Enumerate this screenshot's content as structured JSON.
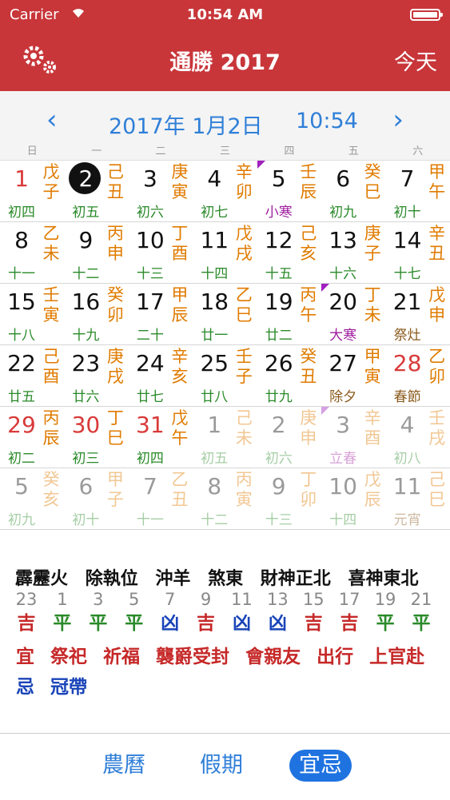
{
  "status": {
    "carrier": "Carrier",
    "time": "10:54 AM"
  },
  "nav": {
    "title": "通勝 2017",
    "today": "今天"
  },
  "subhead": {
    "date": "2017年 1月2日",
    "clock": "10:54",
    "prev": "‹",
    "next": "›"
  },
  "weekdays": [
    "日",
    "一",
    "二",
    "三",
    "四",
    "五",
    "六"
  ],
  "calendar": [
    [
      {
        "day": "1",
        "gz": "戊子",
        "lunar": "初四",
        "red": true
      },
      {
        "day": "2",
        "gz": "己丑",
        "lunar": "初五",
        "selected": true
      },
      {
        "day": "3",
        "gz": "庚寅",
        "lunar": "初六"
      },
      {
        "day": "4",
        "gz": "辛卯",
        "lunar": "初七"
      },
      {
        "day": "5",
        "gz": "壬辰",
        "lunar": "小寒",
        "term": true
      },
      {
        "day": "6",
        "gz": "癸巳",
        "lunar": "初九"
      },
      {
        "day": "7",
        "gz": "甲午",
        "lunar": "初十"
      }
    ],
    [
      {
        "day": "8",
        "gz": "乙未",
        "lunar": "十一"
      },
      {
        "day": "9",
        "gz": "丙申",
        "lunar": "十二"
      },
      {
        "day": "10",
        "gz": "丁酉",
        "lunar": "十三"
      },
      {
        "day": "11",
        "gz": "戊戌",
        "lunar": "十四"
      },
      {
        "day": "12",
        "gz": "己亥",
        "lunar": "十五"
      },
      {
        "day": "13",
        "gz": "庚子",
        "lunar": "十六"
      },
      {
        "day": "14",
        "gz": "辛丑",
        "lunar": "十七"
      }
    ],
    [
      {
        "day": "15",
        "gz": "壬寅",
        "lunar": "十八"
      },
      {
        "day": "16",
        "gz": "癸卯",
        "lunar": "十九"
      },
      {
        "day": "17",
        "gz": "甲辰",
        "lunar": "二十"
      },
      {
        "day": "18",
        "gz": "乙巳",
        "lunar": "廿一"
      },
      {
        "day": "19",
        "gz": "丙午",
        "lunar": "廿二"
      },
      {
        "day": "20",
        "gz": "丁未",
        "lunar": "大寒",
        "term": true
      },
      {
        "day": "21",
        "gz": "戊申",
        "lunar": "祭灶",
        "fest": true
      }
    ],
    [
      {
        "day": "22",
        "gz": "己酉",
        "lunar": "廿五"
      },
      {
        "day": "23",
        "gz": "庚戌",
        "lunar": "廿六"
      },
      {
        "day": "24",
        "gz": "辛亥",
        "lunar": "廿七"
      },
      {
        "day": "25",
        "gz": "壬子",
        "lunar": "廿八"
      },
      {
        "day": "26",
        "gz": "癸丑",
        "lunar": "廿九"
      },
      {
        "day": "27",
        "gz": "甲寅",
        "lunar": "除夕",
        "fest": true
      },
      {
        "day": "28",
        "gz": "乙卯",
        "lunar": "春節",
        "fest": true,
        "red": true
      }
    ],
    [
      {
        "day": "29",
        "gz": "丙辰",
        "lunar": "初二",
        "red": true
      },
      {
        "day": "30",
        "gz": "丁巳",
        "lunar": "初三",
        "red": true
      },
      {
        "day": "31",
        "gz": "戊午",
        "lunar": "初四",
        "red": true
      },
      {
        "day": "1",
        "gz": "己未",
        "lunar": "初五",
        "fade": true
      },
      {
        "day": "2",
        "gz": "庚申",
        "lunar": "初六",
        "fade": true
      },
      {
        "day": "3",
        "gz": "辛酉",
        "lunar": "立春",
        "term": true,
        "fade": true
      },
      {
        "day": "4",
        "gz": "壬戌",
        "lunar": "初八",
        "fade": true
      }
    ],
    [
      {
        "day": "5",
        "gz": "癸亥",
        "lunar": "初九",
        "fade": true
      },
      {
        "day": "6",
        "gz": "甲子",
        "lunar": "初十",
        "fade": true
      },
      {
        "day": "7",
        "gz": "乙丑",
        "lunar": "十一",
        "fade": true
      },
      {
        "day": "8",
        "gz": "丙寅",
        "lunar": "十二",
        "fade": true
      },
      {
        "day": "9",
        "gz": "丁卯",
        "lunar": "十三",
        "fade": true
      },
      {
        "day": "10",
        "gz": "戊辰",
        "lunar": "十四",
        "fade": true
      },
      {
        "day": "11",
        "gz": "己巳",
        "lunar": "元宵",
        "fest": true,
        "fade": true
      }
    ]
  ],
  "info": {
    "line1": [
      "霹靂火",
      "除執位",
      "沖羊",
      "煞東",
      "財神正北",
      "喜神東北"
    ],
    "hours": [
      {
        "n": "23",
        "v": "吉",
        "k": "good"
      },
      {
        "n": "1",
        "v": "平",
        "k": "flat"
      },
      {
        "n": "3",
        "v": "平",
        "k": "flat"
      },
      {
        "n": "5",
        "v": "平",
        "k": "flat"
      },
      {
        "n": "7",
        "v": "凶",
        "k": "bad"
      },
      {
        "n": "9",
        "v": "吉",
        "k": "good"
      },
      {
        "n": "11",
        "v": "凶",
        "k": "bad"
      },
      {
        "n": "13",
        "v": "凶",
        "k": "bad"
      },
      {
        "n": "15",
        "v": "吉",
        "k": "good"
      },
      {
        "n": "17",
        "v": "吉",
        "k": "good"
      },
      {
        "n": "19",
        "v": "平",
        "k": "flat"
      },
      {
        "n": "21",
        "v": "平",
        "k": "flat"
      }
    ],
    "yi_label": "宜",
    "yi": [
      "祭祀",
      "祈福",
      "襲爵受封",
      "會親友",
      "出行",
      "上官赴"
    ],
    "ji_label": "忌",
    "ji": [
      "冠帶"
    ]
  },
  "tabs": [
    "農曆",
    "假期",
    "宜忌"
  ]
}
